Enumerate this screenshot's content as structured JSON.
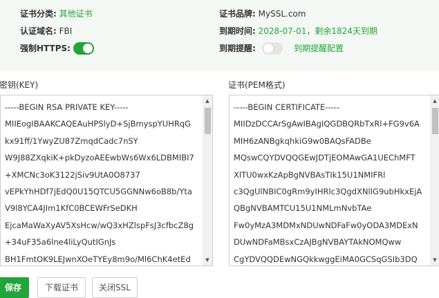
{
  "info": {
    "category_label": "证书分类:",
    "category_value": "其他证书",
    "brand_label": "证书品牌:",
    "brand_value": "MySSL.com",
    "domain_label": "认证域名:",
    "domain_value": "FBI",
    "expire_label": "到期时间:",
    "expire_value": "2028-07-01，剩余1824天到期",
    "https_label": "强制HTTPS:",
    "https_enabled": true,
    "reminder_label": "到期提醒:",
    "reminder_enabled": false,
    "reminder_link": "到期提醒配置"
  },
  "key": {
    "title": "密钥(KEY)",
    "lines": [
      "-----BEGIN RSA PRIVATE KEY-----",
      "MIIEogIBAAKCAQEAuHPSlyD+SjBmyspYUHRqG",
      "kx91ff/1YwyZU87ZmqdCadc7nSY",
      "W9J88ZXqkiK+pkDyzoAEEwbWs6Wx6LDBMIBI7",
      "+XMCNc3oK3122jSiv9UtA0O8737",
      "vEPkYhHDf7jEdQ0U15QTCU5GGNNw6oB8b/Yta",
      "V9l8YCA4JIm1KfC0BCEWFrSeDKH",
      "EjcaMaWaXyAV5XsHcw/wQ3xHZlspFsJ3cfbcZ8g",
      "+34uF35a6lne4liLyQutIGnJs",
      "BH1FmtOK9LEJwnXOeTYEy8m9o/Ml6ChK4etEd"
    ]
  },
  "cert": {
    "title": "证书(PEM格式)",
    "lines": [
      "-----BEGIN CERTIFICATE-----",
      "MIIDzDCCArSgAwIBAgIQGDBQRbTxRl+FG9v6A",
      "MIH6zANBgkqhkiG9w0BAQsFADBe",
      "MQswCQYDVQQGEwJDTjEOMAwGA1UEChMFT",
      "XlTU0wxKzApBgNVBAsTIk15U1NMIFRl",
      "c3QgUlNBIC0gRm9yIHRlc3QgdXNlIG9ubHkxEjA",
      "QBgNVBAMTCU15U1NMLmNvbTAe",
      "Fw0yMzA3MDMxNDUwNDFaFw0yODA3MDExN",
      "DUwNDFaMBsxCzAJBgNVBAYTAkNOMQww",
      "CgYDVQQDEwNGQkkwggEiMA0GCSqGSIb3DQ"
    ]
  },
  "buttons": {
    "save": "保存",
    "download": "下载证书",
    "close_ssl": "关闭SSL"
  },
  "colors": {
    "accent": "#20a53a",
    "panel_bg": "#f4f8f4"
  }
}
